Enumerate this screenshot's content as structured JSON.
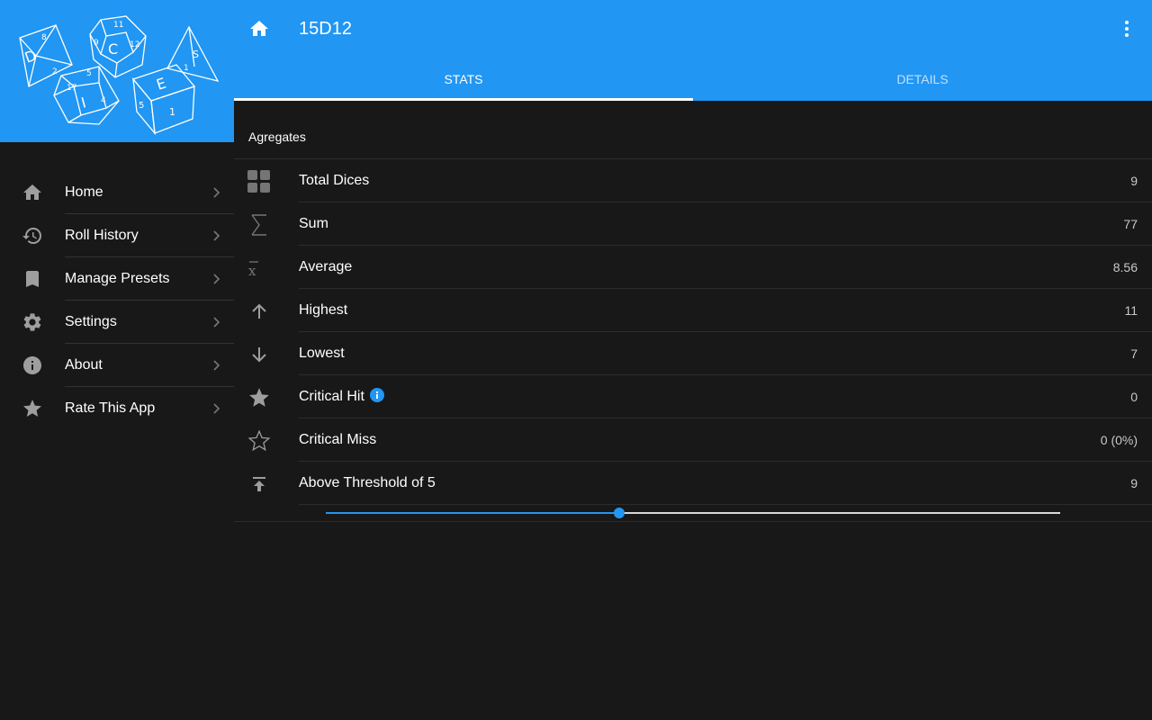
{
  "app": {
    "title": "15D12",
    "accent_color": "#2196f3",
    "logo_letters": [
      "D",
      "I",
      "C",
      "E"
    ]
  },
  "sidebar": {
    "items": [
      {
        "label": "Home",
        "icon": "home-icon"
      },
      {
        "label": "Roll History",
        "icon": "history-icon"
      },
      {
        "label": "Manage Presets",
        "icon": "bookmark-icon"
      },
      {
        "label": "Settings",
        "icon": "gear-icon"
      },
      {
        "label": "About",
        "icon": "info-icon"
      },
      {
        "label": "Rate This App",
        "icon": "star-icon"
      }
    ]
  },
  "tabs": [
    {
      "label": "STATS",
      "active": true
    },
    {
      "label": "DETAILS",
      "active": false
    }
  ],
  "stats": {
    "section_title": "Agregates",
    "rows": [
      {
        "label": "Total Dices",
        "value": "9",
        "icon": "grid-icon"
      },
      {
        "label": "Sum",
        "value": "77",
        "icon": "sigma-icon"
      },
      {
        "label": "Average",
        "value": "8.56",
        "icon": "x-bar-icon"
      },
      {
        "label": "Highest",
        "value": "11",
        "icon": "arrow-up-icon"
      },
      {
        "label": "Lowest",
        "value": "7",
        "icon": "arrow-down-icon"
      },
      {
        "label": "Critical Hit",
        "value": "0",
        "icon": "star-filled-icon"
      },
      {
        "label": "Critical Miss",
        "value": "0 (0%)",
        "icon": "star-outline-icon"
      },
      {
        "label": "Above Threshold of 5",
        "value": "9",
        "icon": "threshold-icon"
      }
    ]
  },
  "threshold_slider": {
    "fraction": 0.4
  }
}
